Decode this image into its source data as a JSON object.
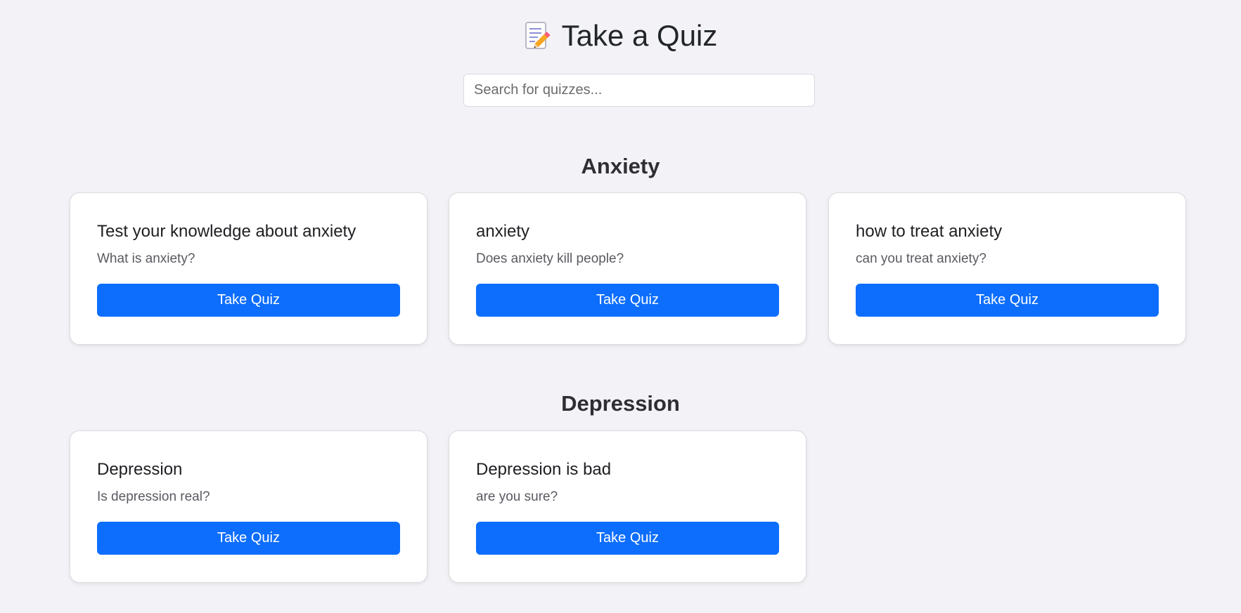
{
  "header": {
    "icon": "memo-pencil-icon",
    "title": "Take a Quiz"
  },
  "search": {
    "placeholder": "Search for quizzes...",
    "value": ""
  },
  "sections": [
    {
      "title": "Anxiety",
      "cards": [
        {
          "title": "Test your knowledge about anxiety",
          "description": "What is anxiety?",
          "button": "Take Quiz"
        },
        {
          "title": "anxiety",
          "description": "Does anxiety kill people?",
          "button": "Take Quiz"
        },
        {
          "title": "how to treat anxiety",
          "description": "can you treat anxiety?",
          "button": "Take Quiz"
        }
      ]
    },
    {
      "title": "Depression",
      "cards": [
        {
          "title": "Depression",
          "description": "Is depression real?",
          "button": "Take Quiz"
        },
        {
          "title": "Depression is bad",
          "description": "are you sure?",
          "button": "Take Quiz"
        }
      ]
    }
  ],
  "colors": {
    "background": "#f3f3f7",
    "button": "#0d6efd",
    "button_text": "#ffffff"
  }
}
